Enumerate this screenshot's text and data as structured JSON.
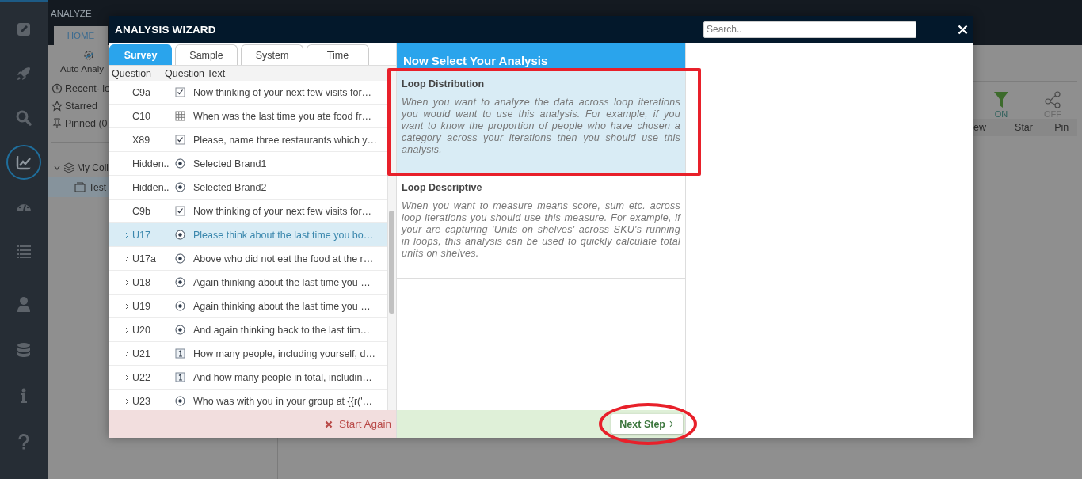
{
  "rail": {
    "top_items": [
      {
        "kind": "pencil",
        "selected": false
      },
      {
        "kind": "rocket",
        "selected": false
      },
      {
        "kind": "search",
        "selected": false
      },
      {
        "kind": "chart",
        "selected": true
      },
      {
        "kind": "gauge",
        "selected": false
      },
      {
        "kind": "list",
        "selected": false
      }
    ],
    "bottom_items": [
      {
        "kind": "user",
        "selected": false
      },
      {
        "kind": "database",
        "selected": false
      },
      {
        "kind": "info",
        "selected": false
      },
      {
        "kind": "help",
        "selected": false
      }
    ]
  },
  "header": {
    "section": "ANALYZE",
    "tabs": [
      {
        "label": "HOME",
        "selected": true
      }
    ]
  },
  "sidebar": {
    "tool": "Auto Analy",
    "links": [
      {
        "kind": "clock",
        "label": "Recent- lo"
      },
      {
        "kind": "star",
        "label": "Starred"
      },
      {
        "kind": "pin",
        "label": "Pinned (0"
      }
    ],
    "tree": [
      {
        "label": "My Coll",
        "expanded": true,
        "children": [
          {
            "label": "Test",
            "selected": true
          }
        ]
      }
    ]
  },
  "toolbar": {
    "toggles": [
      {
        "kind": "filter",
        "state": "ON",
        "on": true
      },
      {
        "kind": "share",
        "state": "OFF",
        "on": false
      }
    ],
    "labels": [
      "ew",
      "Star",
      "Pin"
    ]
  },
  "wizard": {
    "title": "ANALYSIS WIZARD",
    "search": {
      "placeholder": "Search.."
    },
    "tabs": [
      {
        "label": "Survey",
        "selected": true
      },
      {
        "label": "Sample",
        "selected": false
      },
      {
        "label": "System",
        "selected": false
      },
      {
        "label": "Time",
        "selected": false
      }
    ],
    "columns": [
      "Question",
      "Question Text"
    ],
    "rows": [
      {
        "code": "C9a",
        "kind": "checkbox",
        "text": "Now thinking of your next few visits for…",
        "expandable": false,
        "selected": false
      },
      {
        "code": "C10",
        "kind": "grid",
        "text": "When was the last time you ate food fr…",
        "expandable": false,
        "selected": false
      },
      {
        "code": "X89",
        "kind": "checkbox",
        "text": "Please, name three restaurants which y…",
        "expandable": false,
        "selected": false
      },
      {
        "code": "Hidden..",
        "kind": "radio",
        "text": "Selected Brand1",
        "expandable": false,
        "selected": false
      },
      {
        "code": "Hidden..",
        "kind": "radio",
        "text": "Selected Brand2",
        "expandable": false,
        "selected": false
      },
      {
        "code": "C9b",
        "kind": "checkbox",
        "text": "Now thinking of your next few visits for…",
        "expandable": false,
        "selected": false
      },
      {
        "code": "U17",
        "kind": "radio",
        "text": "Please think about the last time you bo…",
        "expandable": true,
        "selected": true
      },
      {
        "code": "U17a",
        "kind": "radio",
        "text": "Above who did not eat the food at the r…",
        "expandable": true,
        "selected": false
      },
      {
        "code": "U18",
        "kind": "radio",
        "text": "Again thinking about the last time you …",
        "expandable": true,
        "selected": false
      },
      {
        "code": "U19",
        "kind": "radio",
        "text": "Again thinking about the last time you …",
        "expandable": true,
        "selected": false
      },
      {
        "code": "U20",
        "kind": "radio",
        "text": "And again thinking back to the last tim…",
        "expandable": true,
        "selected": false
      },
      {
        "code": "U21",
        "kind": "numeric",
        "text": "How many people, including yourself, d…",
        "expandable": true,
        "selected": false
      },
      {
        "code": "U22",
        "kind": "numeric",
        "text": "And how many people in total, includin…",
        "expandable": true,
        "selected": false
      },
      {
        "code": "U23",
        "kind": "radio",
        "text": "Who was with you in your group at {{r('…",
        "expandable": true,
        "selected": false
      }
    ],
    "start_again": "Start Again",
    "analysis": {
      "heading": "Now Select Your Analysis",
      "options": [
        {
          "title": "Loop Distribution",
          "description": "When you want to analyze the data across loop iterations you would want to use this analysis. For example, if you want to know the proportion of people who have chosen a category across your iterations then you should use this analysis.",
          "selected": true
        },
        {
          "title": "Loop Descriptive",
          "description": "When you want to measure means score, sum etc. across loop iterations you should use this measure. For example, if your are capturing 'Units on shelves' across SKU's running in loops, this analysis can be used to quickly calculate total units on shelves.",
          "selected": false
        }
      ]
    },
    "next": "Next Step"
  },
  "annotations": [
    {
      "kind": "rectangle"
    },
    {
      "kind": "ellipse"
    }
  ]
}
